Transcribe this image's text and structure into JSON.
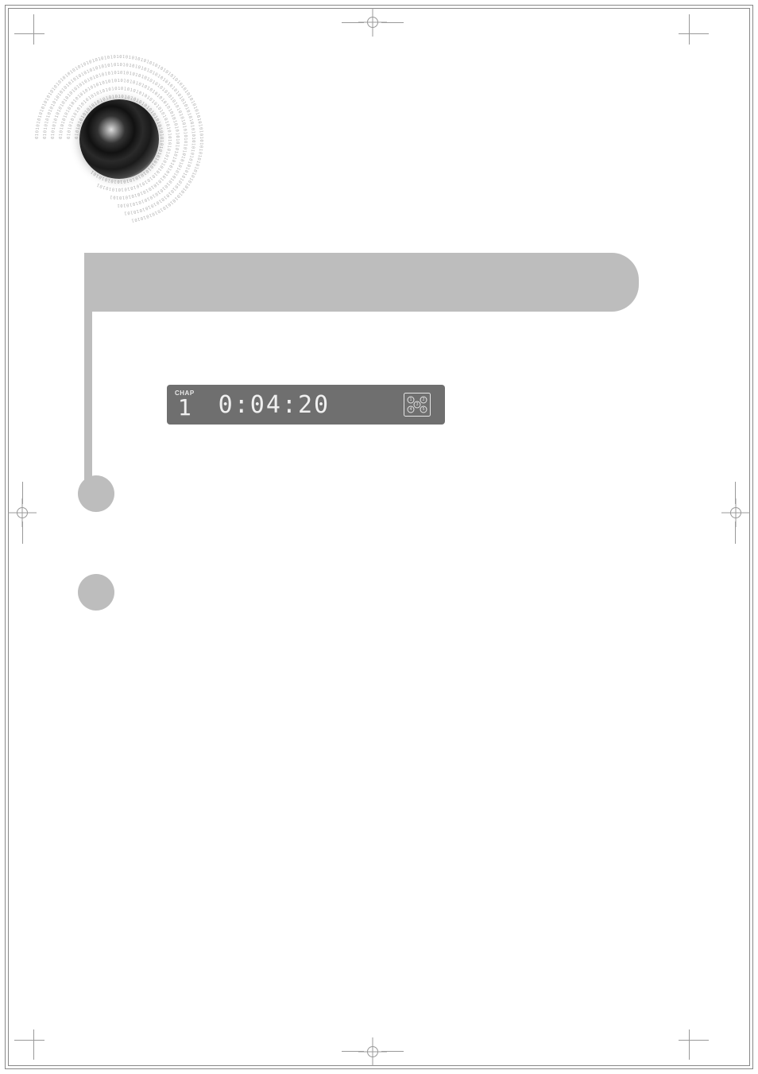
{
  "display": {
    "chapter_label": "CHAP",
    "chapter_number": "1",
    "time": "0:04:20",
    "speaker_icon_numbers": [
      "1",
      "2",
      "3",
      "4",
      "5"
    ]
  },
  "chart_data": null
}
